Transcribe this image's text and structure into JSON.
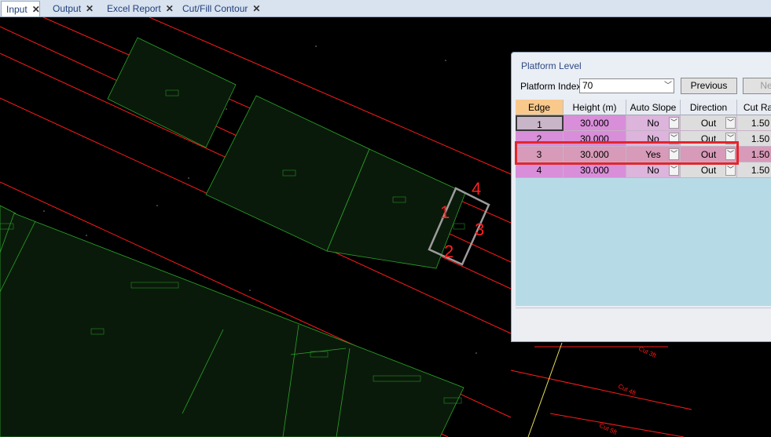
{
  "tabs": [
    {
      "label": "Input",
      "close": "✕"
    },
    {
      "label": "Output",
      "close": "✕"
    },
    {
      "label": "Excel Report",
      "close": "✕"
    },
    {
      "label": "Cut/Fill Contour",
      "close": "✕"
    }
  ],
  "cad": {
    "markers": [
      "1",
      "2",
      "3",
      "4"
    ],
    "contour_labels": [
      "Cut 3ft",
      "Cut 4ft",
      "Cut 5ft"
    ],
    "line_color": "#ff1a1a",
    "parcel_color": "#2aa52a"
  },
  "dialog": {
    "title": "Platform Level",
    "platform_index_label": "Platform Index",
    "platform_index_value": "70",
    "previous_label": "Previous",
    "next_label": "Ne",
    "columns": [
      "Edge",
      "Height (m)",
      "Auto Slope",
      "Direction",
      "Cut Rati"
    ],
    "rows": [
      {
        "edge": "1",
        "height": "30.000",
        "auto_slope": "No",
        "direction": "Out",
        "cut_ratio": "1.50"
      },
      {
        "edge": "2",
        "height": "30.000",
        "auto_slope": "No",
        "direction": "Out",
        "cut_ratio": "1.50"
      },
      {
        "edge": "3",
        "height": "30.000",
        "auto_slope": "Yes",
        "direction": "Out",
        "cut_ratio": "1.50"
      },
      {
        "edge": "4",
        "height": "30.000",
        "auto_slope": "No",
        "direction": "Out",
        "cut_ratio": "1.50"
      }
    ],
    "highlight_color": "#e3262c"
  }
}
